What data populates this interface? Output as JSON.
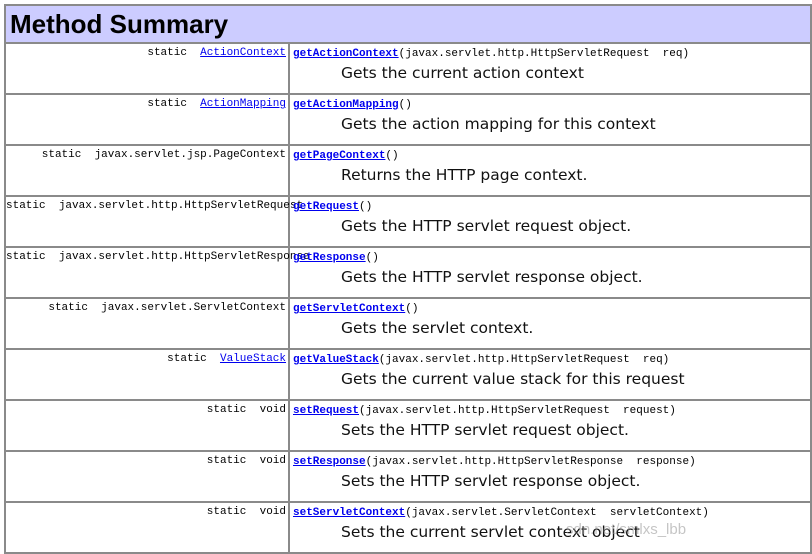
{
  "title": "Method Summary",
  "rows": [
    {
      "mod_prefix": "static  ",
      "type_link": "ActionContext",
      "type_plain": "",
      "method": "getActionContext",
      "params": "(javax.servlet.http.HttpServletRequest  req)",
      "desc": "Gets the current action context"
    },
    {
      "mod_prefix": "static  ",
      "type_link": "ActionMapping",
      "type_plain": "",
      "method": "getActionMapping",
      "params": "()",
      "desc": "Gets the action mapping for this context"
    },
    {
      "mod_prefix": "static  ",
      "type_link": "",
      "type_plain": "javax.servlet.jsp.PageContext",
      "method": "getPageContext",
      "params": "()",
      "desc": "Returns the HTTP page context."
    },
    {
      "mod_prefix": "static  ",
      "type_link": "",
      "type_plain": "javax.servlet.http.HttpServletRequest",
      "method": "getRequest",
      "params": "()",
      "desc": "Gets the HTTP servlet request object."
    },
    {
      "mod_prefix": "static  ",
      "type_link": "",
      "type_plain": "javax.servlet.http.HttpServletResponse",
      "method": "getResponse",
      "params": "()",
      "desc": "Gets the HTTP servlet response object."
    },
    {
      "mod_prefix": "static  ",
      "type_link": "",
      "type_plain": "javax.servlet.ServletContext",
      "method": "getServletContext",
      "params": "()",
      "desc": "Gets the servlet context."
    },
    {
      "mod_prefix": "static  ",
      "type_link": "ValueStack",
      "type_plain": "",
      "method": "getValueStack",
      "params": "(javax.servlet.http.HttpServletRequest  req)",
      "desc": "Gets the current value stack for this request"
    },
    {
      "mod_prefix": "static  ",
      "type_link": "",
      "type_plain": "void",
      "method": "setRequest",
      "params": "(javax.servlet.http.HttpServletRequest  request)",
      "desc": "Sets the HTTP servlet request object."
    },
    {
      "mod_prefix": "static  ",
      "type_link": "",
      "type_plain": "void",
      "method": "setResponse",
      "params": "(javax.servlet.http.HttpServletResponse  response)",
      "desc": "Sets the HTTP servlet response object."
    },
    {
      "mod_prefix": "static  ",
      "type_link": "",
      "type_plain": "void",
      "method": "setServletContext",
      "params": "(javax.servlet.ServletContext  servletContext)",
      "desc": "Sets the current servlet context object"
    }
  ],
  "watermark": "sdn.net/smlxs_lbb"
}
